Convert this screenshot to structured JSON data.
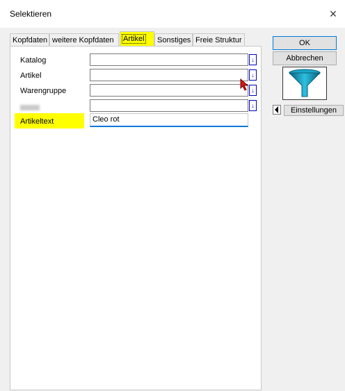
{
  "window": {
    "title": "Selektieren",
    "close_icon": "×"
  },
  "tabs": [
    {
      "label": "Kopfdaten"
    },
    {
      "label": "weitere Kopfdaten"
    },
    {
      "label": "Artikel",
      "active": true
    },
    {
      "label": "Sonstiges"
    },
    {
      "label": "Freie Struktur"
    }
  ],
  "fields": {
    "katalog": {
      "label": "Katalog",
      "value": ""
    },
    "artikel": {
      "label": "Artikel",
      "value": ""
    },
    "warengruppe": {
      "label": "Warengruppe",
      "value": ""
    },
    "blurred": {
      "value": ""
    },
    "artikeltext": {
      "label": "Artikeltext",
      "value": "Cleo rot"
    }
  },
  "dropdown_icon": "↓",
  "buttons": {
    "ok": "OK",
    "cancel": "Abbrechen",
    "settings": "Einstellungen"
  },
  "colors": {
    "highlight": "#ffff00",
    "accent": "#0078d7",
    "dropdown": "#0000c0"
  }
}
